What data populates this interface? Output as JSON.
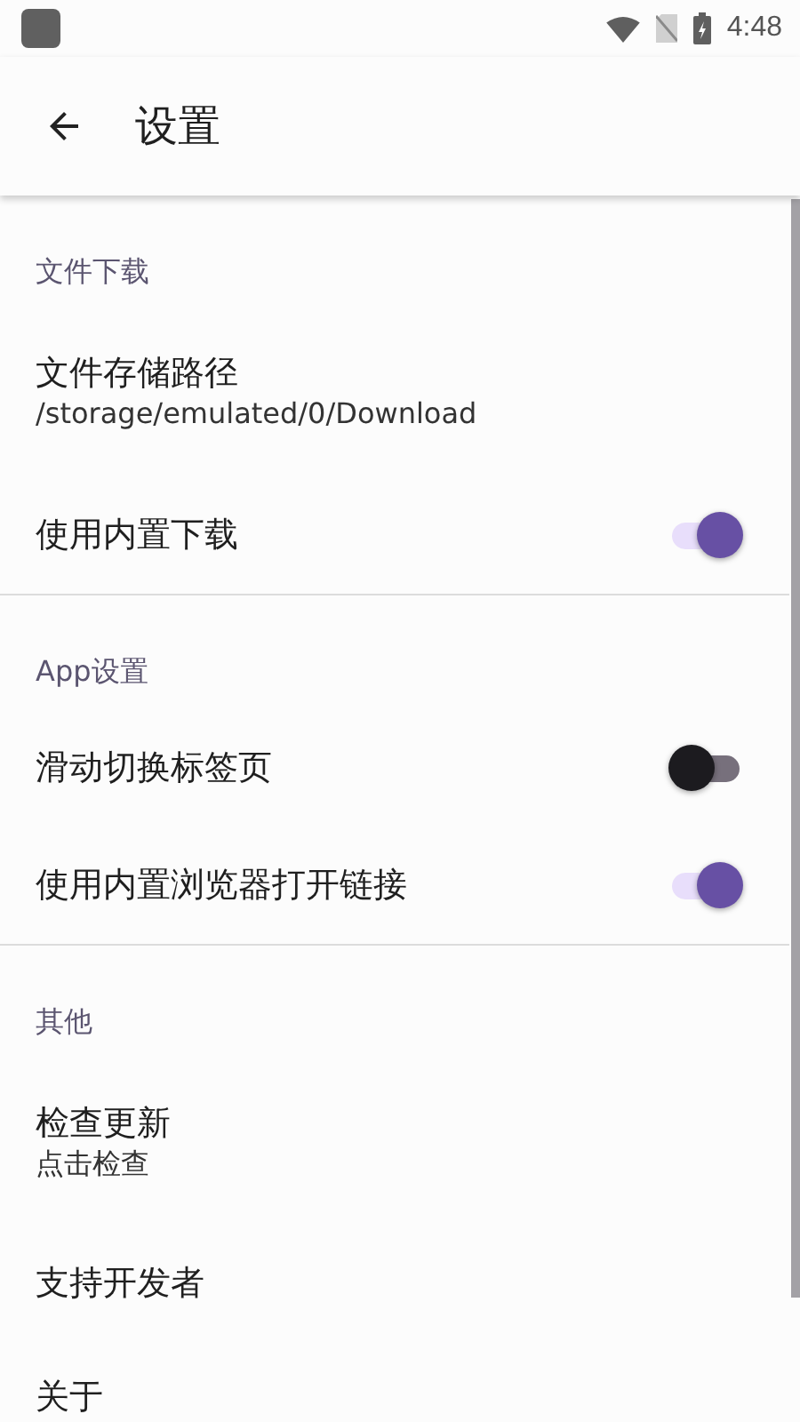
{
  "status_bar": {
    "time": "4:48"
  },
  "toolbar": {
    "title": "设置"
  },
  "sections": [
    {
      "header": "文件下载",
      "items": [
        {
          "kind": "text",
          "title": "文件存储路径",
          "subtitle": "/storage/emulated/0/Download"
        },
        {
          "kind": "switch",
          "title": "使用内置下载",
          "on": true
        }
      ]
    },
    {
      "header": "App设置",
      "items": [
        {
          "kind": "switch",
          "title": "滑动切换标签页",
          "on": false
        },
        {
          "kind": "switch",
          "title": "使用内置浏览器打开链接",
          "on": true
        }
      ]
    },
    {
      "header": "其他",
      "items": [
        {
          "kind": "text",
          "title": "检查更新",
          "subtitle": "点击检查"
        },
        {
          "kind": "text",
          "title": "支持开发者"
        },
        {
          "kind": "text",
          "title": "关于"
        }
      ]
    }
  ]
}
